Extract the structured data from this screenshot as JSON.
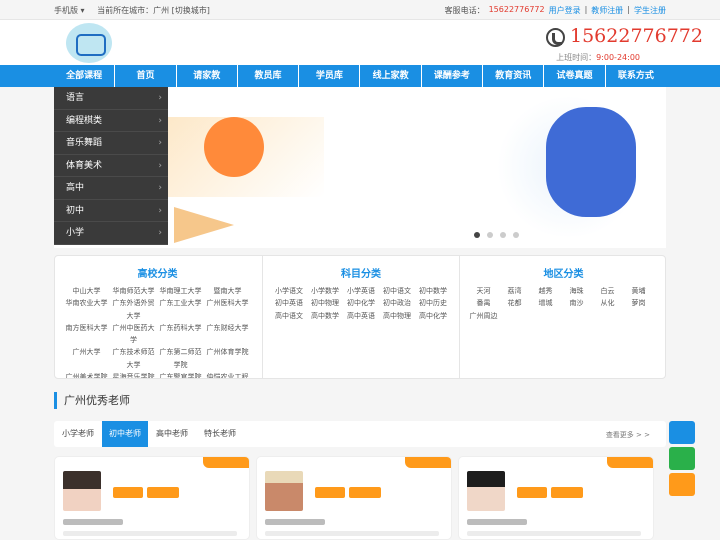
{
  "topbar": {
    "mobile_label": "手机版 ▾",
    "city_label": "当前所在城市：广州 [切换城市]",
    "hotline_label": "客服电话：",
    "hotline_number": "15622776772",
    "user_login": "用户登录",
    "teacher_register": "教师注册",
    "student_register": "学生注册",
    "separator": "|"
  },
  "header": {
    "hotline": "15622776772",
    "hours_label": "上班时间：",
    "hours_value": "9:00-24:00"
  },
  "nav": {
    "items": [
      "全部课程",
      "首页",
      "请家教",
      "教员库",
      "学员库",
      "线上家教",
      "课酬参考",
      "教育资讯",
      "试卷真题",
      "联系方式"
    ]
  },
  "category_menu": {
    "items": [
      "语言",
      "编程棋类",
      "音乐舞蹈",
      "体育美术",
      "高中",
      "初中",
      "小学"
    ]
  },
  "categories": {
    "universities": {
      "title": "高校分类",
      "links": [
        "中山大学",
        "华南师范大学",
        "华南理工大学",
        "暨南大学",
        "华南农业大学",
        "广东外语外贸大学",
        "广东工业大学",
        "广州医科大学",
        "南方医科大学",
        "广州中医药大学",
        "广东药科大学",
        "广东财经大学",
        "广州大学",
        "广东技术师范大学",
        "广东第二师范学院",
        "广州体育学院",
        "广州美术学院",
        "星海音乐学院",
        "广东警官学院",
        "仲恺农业工程学院",
        "广东金融学院"
      ]
    },
    "subjects": {
      "title": "科目分类",
      "links": [
        "小学语文",
        "小学数学",
        "小学英语",
        "初中语文",
        "初中数学",
        "初中英语",
        "初中物理",
        "初中化学",
        "初中政治",
        "初中历史",
        "高中语文",
        "高中数学",
        "高中英语",
        "高中物理",
        "高中化学"
      ]
    },
    "areas": {
      "title": "地区分类",
      "links": [
        "天河",
        "荔湾",
        "越秀",
        "海珠",
        "白云",
        "黄埔",
        "番禺",
        "花都",
        "增城",
        "南沙",
        "从化",
        "萝岗",
        "广州周边"
      ]
    }
  },
  "section": {
    "title": "广州优秀老师"
  },
  "tabs": {
    "items": [
      "小学老师",
      "初中老师",
      "高中老师",
      "特长老师"
    ],
    "active_index": 1,
    "more": "查看更多 > >"
  },
  "theme": {
    "accent": "#1a8fe3",
    "hotline_color": "#e23a2e",
    "badge_orange": "#ff9a1a",
    "menu_dark": "#3a3a3a"
  }
}
